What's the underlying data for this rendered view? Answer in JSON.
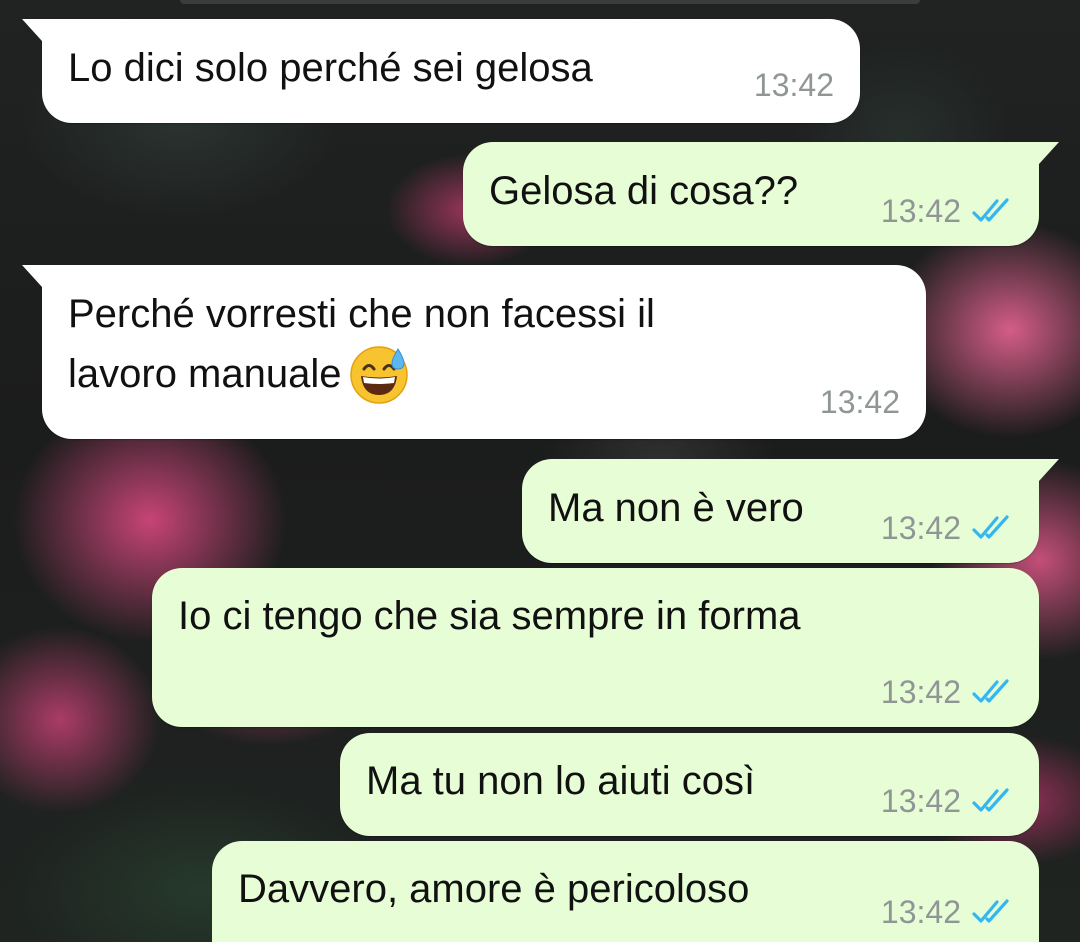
{
  "chat": {
    "messages": [
      {
        "direction": "incoming",
        "text": "Lo dici solo perché sei gelosa",
        "time": "13:42"
      },
      {
        "direction": "outgoing",
        "text": "Gelosa di cosa??",
        "time": "13:42",
        "status": "read",
        "status_icon": "double-check-icon"
      },
      {
        "direction": "incoming",
        "text_line1": "Perché vorresti che non facessi il",
        "text_line2": "lavoro manuale",
        "emoji": "grinning-face-with-sweat",
        "time": "13:42"
      },
      {
        "direction": "outgoing",
        "text": "Ma non è vero",
        "time": "13:42",
        "status": "read",
        "status_icon": "double-check-icon"
      },
      {
        "direction": "outgoing",
        "text": "Io ci tengo che sia sempre in forma",
        "time": "13:42",
        "status": "read",
        "status_icon": "double-check-icon"
      },
      {
        "direction": "outgoing",
        "text": "Ma tu non lo aiuti così",
        "time": "13:42",
        "status": "read",
        "status_icon": "double-check-icon"
      },
      {
        "direction": "outgoing",
        "text": "Davvero, amore è pericoloso",
        "time": "13:42",
        "status": "read",
        "status_icon": "double-check-icon"
      }
    ]
  },
  "colors": {
    "incoming_bubble": "#ffffff",
    "outgoing_bubble": "#e7fdd6",
    "read_check": "#34b7f1",
    "timestamp": "#909696",
    "wallpaper_rose": "#d0467a"
  }
}
